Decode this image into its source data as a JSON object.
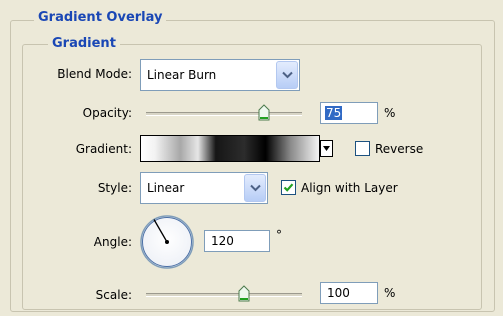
{
  "panel": {
    "outer_title": "Gradient Overlay",
    "inner_title": "Gradient"
  },
  "blend_mode": {
    "label": "Blend Mode:",
    "value": "Linear Burn"
  },
  "opacity": {
    "label": "Opacity:",
    "value": "75",
    "unit": "%",
    "slider_fraction": 0.75
  },
  "gradient": {
    "label": "Gradient:",
    "reverse_label": "Reverse",
    "reverse_checked": false
  },
  "style": {
    "label": "Style:",
    "value": "Linear",
    "align_label": "Align with Layer",
    "align_checked": true
  },
  "angle": {
    "label": "Angle:",
    "value": "120",
    "unit": "°"
  },
  "scale": {
    "label": "Scale:",
    "value": "100",
    "unit": "%",
    "slider_fraction": 0.67
  },
  "colors": {
    "title_blue": "#1a47b5",
    "panel_bg": "#ece9d8",
    "selection": "#316ac5"
  }
}
